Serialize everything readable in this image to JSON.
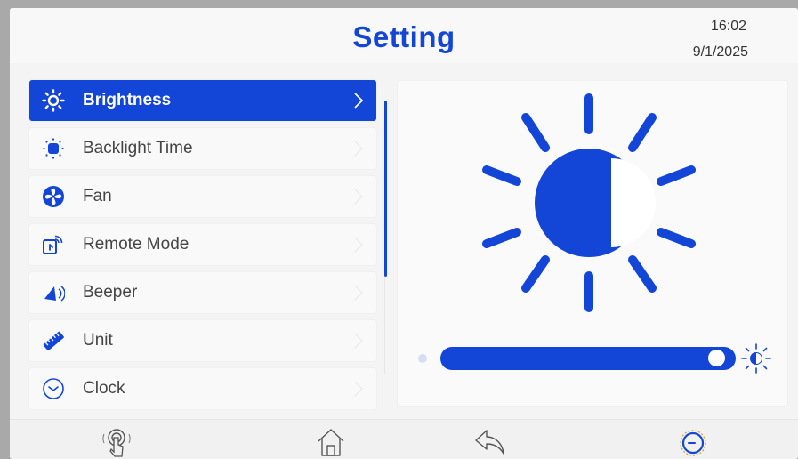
{
  "header": {
    "title": "Setting",
    "time": "16:02",
    "date": "9/1/2025"
  },
  "menu": {
    "items": [
      {
        "label": "Brightness",
        "icon": "brightness-icon",
        "active": true
      },
      {
        "label": "Backlight Time",
        "icon": "backlight-icon",
        "active": false
      },
      {
        "label": "Fan",
        "icon": "fan-icon",
        "active": false
      },
      {
        "label": "Remote Mode",
        "icon": "remote-icon",
        "active": false
      },
      {
        "label": "Beeper",
        "icon": "speaker-icon",
        "active": false
      },
      {
        "label": "Unit",
        "icon": "ruler-icon",
        "active": false
      },
      {
        "label": "Clock",
        "icon": "clock-icon",
        "active": false
      }
    ]
  },
  "brightness": {
    "level": 0.97
  },
  "bottom_nav": [
    "touch-icon",
    "home-icon",
    "back-icon",
    "power-icon"
  ],
  "colors": {
    "accent": "#1346d6",
    "background": "#f4f4f4"
  }
}
